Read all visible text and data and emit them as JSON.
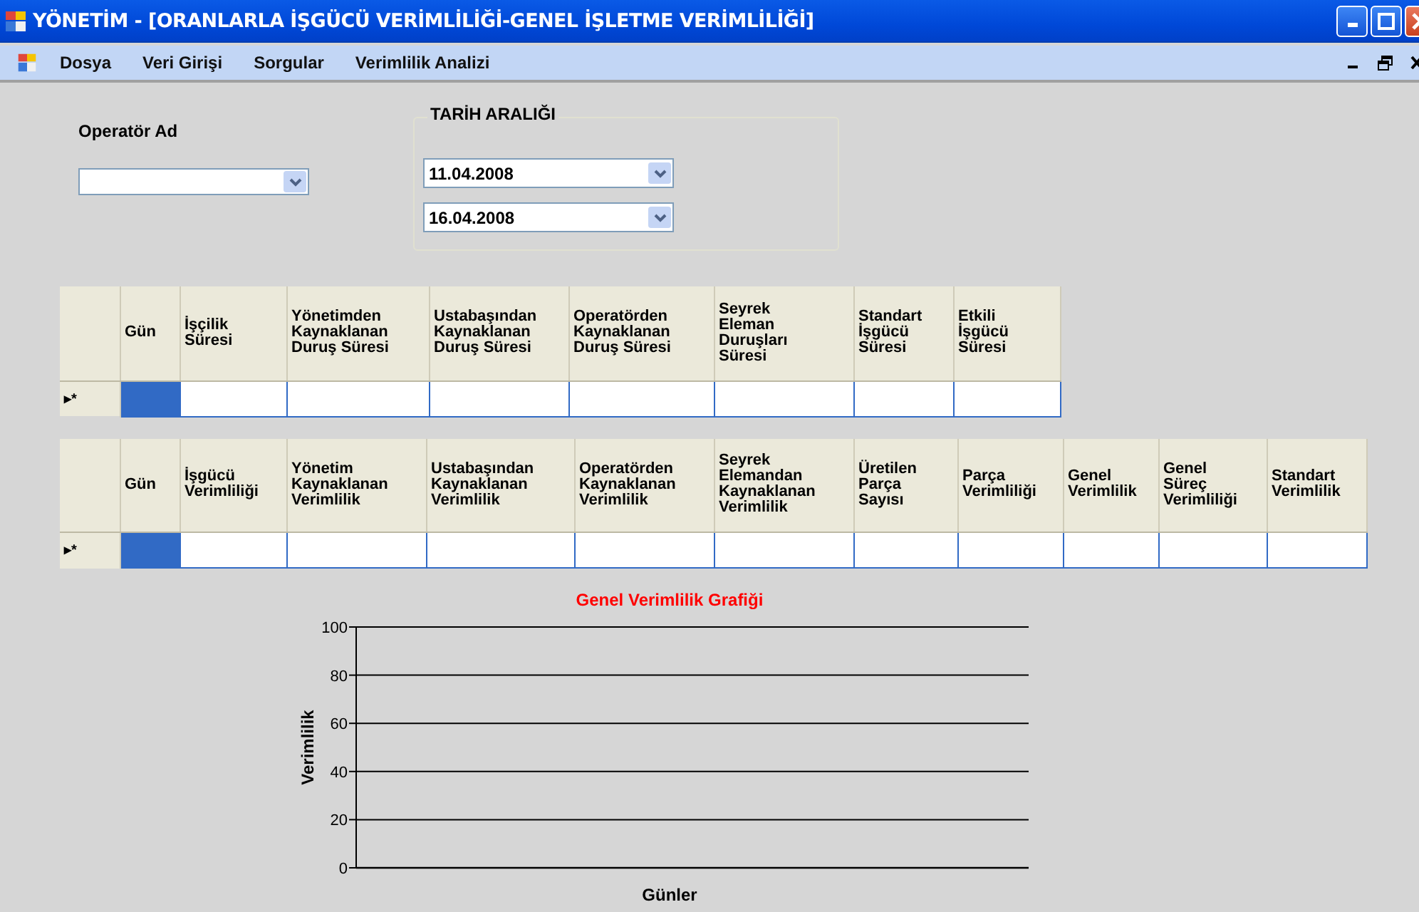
{
  "window": {
    "title": "YÖNETİM - [ORANLARLA İŞGÜCÜ VERİMLİLİĞİ-GENEL İŞLETME VERİMLİLİĞİ]"
  },
  "menu": [
    "Dosya",
    "Veri Girişi",
    "Sorgular",
    "Verimlilik Analizi"
  ],
  "operator": {
    "label": "Operatör Ad"
  },
  "date_range": {
    "title": "TARİH ARALIĞI",
    "start": "11.04.2008",
    "end": "16.04.2008"
  },
  "grid_1": {
    "columns": [
      "Gün",
      "İşçilik\nSüresi",
      "Yönetimden\nKaynaklanan\nDuruş Süresi",
      "Ustabaşından\nKaynaklanan\nDuruş Süresi",
      "Operatörden\nKaynaklanan\nDuruş Süresi",
      "Seyrek\nEleman\nDuruşları\nSüresi",
      "Standart\nİşgücü\nSüresi",
      "Etkili\nİşgücü\nSüresi"
    ],
    "rows": [
      {
        "marker": "▸*",
        "cells": [
          {
            "selected": true
          },
          {
            "selected": false
          },
          {
            "selected": false
          },
          {
            "selected": false
          },
          {
            "selected": false
          },
          {
            "selected": false
          },
          {
            "selected": false
          },
          {
            "selected": false
          }
        ]
      }
    ]
  },
  "grid_2": {
    "columns": [
      "Gün",
      "İşgücü\nVerimliliği",
      "Yönetim\nKaynaklanan\n Verimlilik",
      "Ustabaşından\nKaynaklanan\nVerimlilik",
      "Operatörden\nKaynaklanan\n Verimlilik",
      "Seyrek\nElemandan\nKaynaklanan\n Verimlilik",
      "Üretilen\nParça\nSayısı",
      "Parça\nVerimliliği",
      "Genel\nVerimlilik",
      "Genel\nSüreç\nVerimliliği",
      "Standart\nVerimlilik"
    ],
    "rows": [
      {
        "marker": "▸*",
        "cells": [
          {
            "selected": true
          },
          {
            "selected": false
          },
          {
            "selected": false
          },
          {
            "selected": false
          },
          {
            "selected": false
          },
          {
            "selected": false
          },
          {
            "selected": false
          },
          {
            "selected": false
          },
          {
            "selected": false
          },
          {
            "selected": false
          },
          {
            "selected": false
          }
        ]
      }
    ]
  },
  "chart": {
    "chart_data": {
      "type": "line",
      "grid": true,
      "categories": [
        null
      ],
      "values": [
        null
      ],
      "title": "Genel Verimlilik Grafiği",
      "xlabel": "Günler",
      "ylabel": "Verimlilik",
      "ylim": [
        0,
        100
      ],
      "yticks": [
        0,
        20,
        40,
        60,
        80,
        100
      ]
    }
  }
}
